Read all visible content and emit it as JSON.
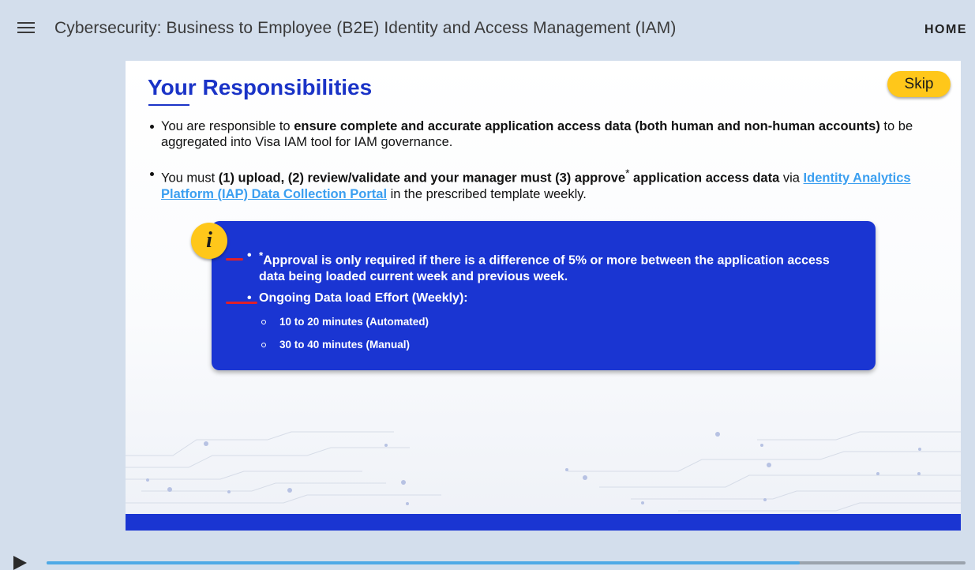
{
  "header": {
    "menu_icon": "hamburger-menu-icon",
    "course_title": "Cybersecurity: Business to Employee (B2E) Identity and Access Management (IAM)",
    "home_label": "HOME"
  },
  "slide": {
    "title": "Your Responsibilities",
    "skip_label": "Skip",
    "bullet1": {
      "pre": "You are responsible to ",
      "bold": "ensure complete and accurate application access data (both human and non-human accounts)",
      "post": " to be aggregated into Visa IAM tool for IAM governance."
    },
    "bullet2": {
      "pre": "You must ",
      "bold": "(1) upload, (2) review/validate and your manager must (3) approve",
      "sup": "*",
      "bold2": " application access data",
      "mid": " via ",
      "link": "Identity Analytics Platform (IAP) Data Collection Portal",
      "post": " in the prescribed template weekly."
    },
    "info": {
      "icon_letter": "i",
      "note1_sup": "*",
      "note1": "Approval is only required if there is a difference of 5% or more between the application access data being loaded current week and previous week.",
      "note2": "Ongoing Data load Effort (Weekly):",
      "sub1": "10 to 20 minutes (Automated)",
      "sub2": "30 to 40 minutes (Manual)"
    }
  },
  "player": {
    "play_icon": "play-icon",
    "progress": 0.82
  },
  "colors": {
    "accent_blue": "#1a35d2",
    "title_blue": "#1a33c7",
    "skip_yellow": "#ffc71a",
    "link_blue": "#3b9ff0"
  }
}
